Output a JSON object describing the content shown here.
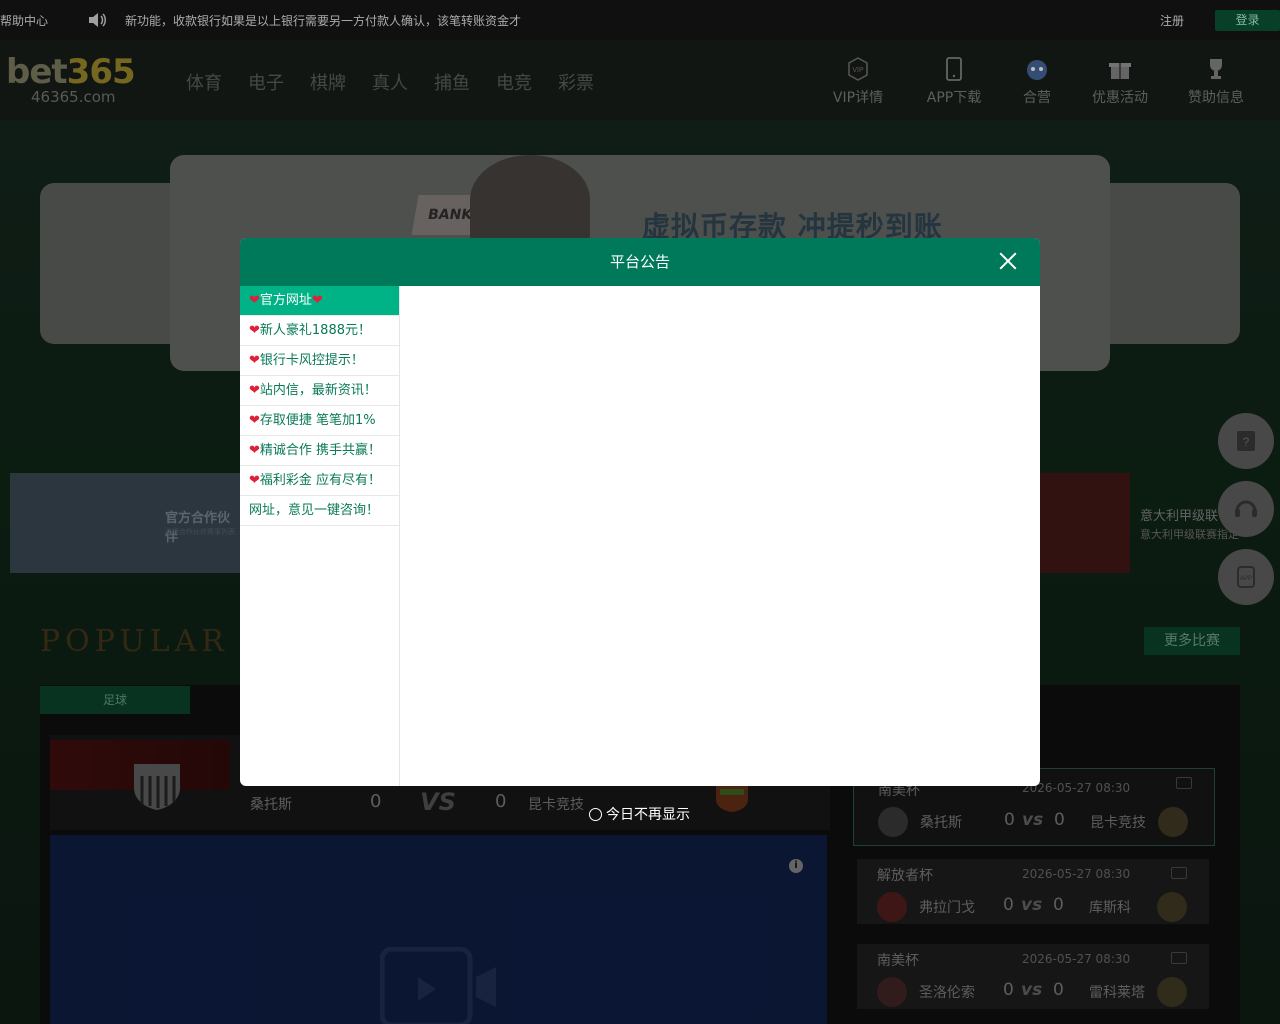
{
  "topbar": {
    "help": "帮助中心",
    "notice": "新功能，收款银行如果是以上银行需要另一方付款人确认，该笔转账资金才",
    "register": "注册",
    "login": "登录"
  },
  "logo": {
    "brand_a": "bet",
    "brand_b": "365",
    "domain": "46365.com"
  },
  "nav": [
    "体育",
    "电子",
    "棋牌",
    "真人",
    "捕鱼",
    "电竞",
    "彩票"
  ],
  "header_icons": [
    {
      "label": "VIP详情",
      "icon": "vip-icon"
    },
    {
      "label": "APP下载",
      "icon": "phone-icon"
    },
    {
      "label": "合营",
      "icon": "partner-icon"
    },
    {
      "label": "优惠活动",
      "icon": "gift-icon"
    },
    {
      "label": "赞助信息",
      "icon": "trophy-icon"
    }
  ],
  "banner": {
    "bank": "BANK",
    "headline": "虚拟币存款  冲提秒到账"
  },
  "partners": {
    "left_title": "官方合作伙伴",
    "left_sub": "品牌合作伙伴赛事列表",
    "right_title": "意大利甲级联",
    "right_sub": "意大利甲级联赛指定"
  },
  "popular": {
    "title": "POPULAR  LI",
    "more": "更多比赛",
    "tab": "足球"
  },
  "featured_match": {
    "home": "桑托斯",
    "home_score": "0",
    "vs": "VS",
    "away_score": "0",
    "away": "昆卡竞技"
  },
  "match_cards": [
    {
      "league": "南美杯",
      "time": "2026-05-27 08:30",
      "home": "桑托斯",
      "home_score": "0",
      "vs": "vs",
      "away_score": "0",
      "away": "昆卡竞技"
    },
    {
      "league": "解放者杯",
      "time": "2026-05-27 08:30",
      "home": "弗拉门戈",
      "home_score": "0",
      "vs": "vs",
      "away_score": "0",
      "away": "库斯科"
    },
    {
      "league": "南美杯",
      "time": "2026-05-27 08:30",
      "home": "圣洛伦索",
      "home_score": "0",
      "vs": "vs",
      "away_score": "0",
      "away": "雷科莱塔"
    }
  ],
  "modal": {
    "title": "平台公告",
    "items": [
      {
        "text": "官方网址",
        "heart_before": true,
        "heart_after": true
      },
      {
        "text": "新人豪礼1888元！",
        "heart_before": true
      },
      {
        "text": "银行卡风控提示！",
        "heart_before": true
      },
      {
        "text": "站内信，最新资讯！",
        "heart_before": true
      },
      {
        "text": "存取便捷  笔笔加1%",
        "heart_before": true
      },
      {
        "text": "精诚合作  携手共赢！",
        "heart_before": true
      },
      {
        "text": "福利彩金  应有尽有！",
        "heart_before": true
      },
      {
        "text": "网址，意见一键咨询！",
        "heart_before": false
      }
    ],
    "no_show": "今日不再显示"
  },
  "colors": {
    "accent": "#00795a",
    "active_item": "#00b386",
    "item_text": "#0a7a58",
    "heart": "#e0203a"
  }
}
